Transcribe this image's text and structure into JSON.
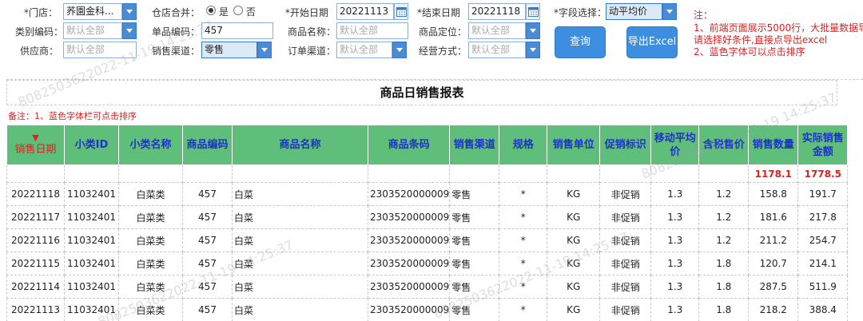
{
  "filters": {
    "store": {
      "label": "*门店：",
      "value": "荞園金科..."
    },
    "merge_store": {
      "label": "仓店合并：",
      "yes": "是",
      "no": "否",
      "selected": "yes"
    },
    "start_date": {
      "label": "*开始日期",
      "value": "20221113"
    },
    "end_date": {
      "label": "*结束日期",
      "value": "20221118"
    },
    "field_select": {
      "label": "*字段选择：",
      "value": "动平均价"
    },
    "category": {
      "label": "类别编码：",
      "placeholder": "默认全部"
    },
    "item_code": {
      "label": "单品编码：",
      "value": "457"
    },
    "item_name": {
      "label": "商品名称：",
      "placeholder": "默认全部"
    },
    "item_position": {
      "label": "商品定位：",
      "placeholder": "默认全部"
    },
    "supplier": {
      "label": "供应商：",
      "placeholder": "默认全部"
    },
    "sales_channel": {
      "label": "销售渠道：",
      "value": "零售"
    },
    "order_channel": {
      "label": "订单渠道：",
      "placeholder": "默认全部"
    },
    "operation_mode": {
      "label": "经营方式：",
      "placeholder": "默认全部"
    }
  },
  "buttons": {
    "query": "查询",
    "export": "导出Excel"
  },
  "notes": {
    "title": "注：",
    "line1": "1、前端页面展示5000行，大批量数据导出",
    "line2": "请选择好条件,直接点导出excel",
    "line3": "2、蓝色字体可以点击排序"
  },
  "report": {
    "title": "商品日销售报表",
    "remark": "备注：1、蓝色字体栏可点击排序",
    "sort_indicator": "▼",
    "columns": [
      "销售日期",
      "小类ID",
      "小类名称",
      "商品编码",
      "商品名称",
      "商品条码",
      "销售渠道",
      "规格",
      "销售单位",
      "促销标识",
      "移动平均价",
      "含税售价",
      "销售数量",
      "实际销售金额"
    ],
    "totals": {
      "sales_qty": "1178.1",
      "actual_amount": "1778.5"
    },
    "rows": [
      [
        "20221118",
        "11032401",
        "白菜类",
        "457",
        "白菜",
        "2303520000009",
        "零售",
        "*",
        "KG",
        "非促销",
        "1.3",
        "1.2",
        "158.8",
        "191.7"
      ],
      [
        "20221117",
        "11032401",
        "白菜类",
        "457",
        "白菜",
        "2303520000009",
        "零售",
        "*",
        "KG",
        "非促销",
        "1.3",
        "1.2",
        "181.6",
        "217.8"
      ],
      [
        "20221116",
        "11032401",
        "白菜类",
        "457",
        "白菜",
        "2303520000009",
        "零售",
        "*",
        "KG",
        "非促销",
        "1.3",
        "1.2",
        "211.2",
        "254.7"
      ],
      [
        "20221115",
        "11032401",
        "白菜类",
        "457",
        "白菜",
        "2303520000009",
        "零售",
        "*",
        "KG",
        "非促销",
        "1.3",
        "1.8",
        "120.7",
        "214.1"
      ],
      [
        "20221114",
        "11032401",
        "白菜类",
        "457",
        "白菜",
        "2303520000009",
        "零售",
        "*",
        "KG",
        "非促销",
        "1.3",
        "1.8",
        "287.5",
        "511.9"
      ],
      [
        "20221113",
        "11032401",
        "白菜类",
        "457",
        "白菜",
        "2303520000009",
        "零售",
        "*",
        "KG",
        "非促销",
        "1.3",
        "1.8",
        "218.2",
        "388.4"
      ]
    ]
  },
  "watermark": "8082503622022-11-19 14:25:37",
  "colors": {
    "header_bg": "#5fbf7a",
    "sortable_text": "#1d33c8",
    "accent_red": "#e02020",
    "button_blue": "#3e8ee0"
  }
}
